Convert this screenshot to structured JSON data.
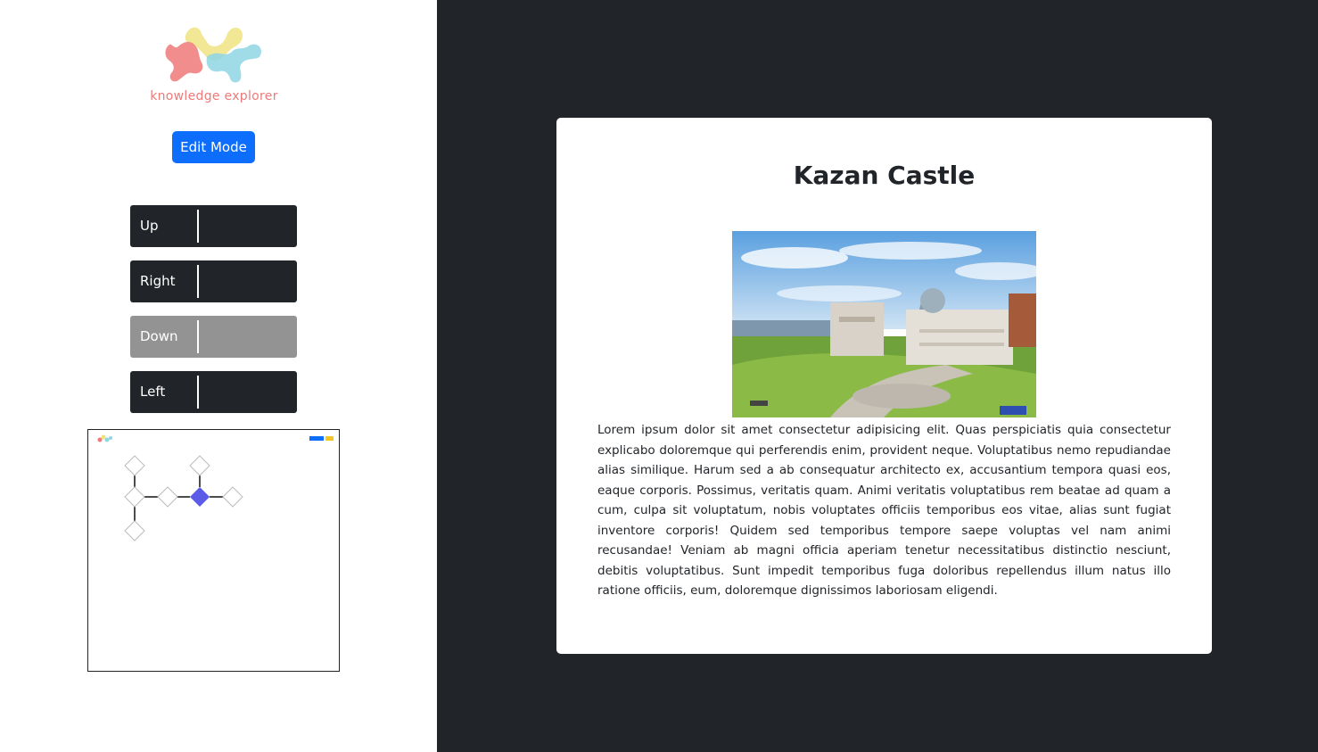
{
  "app": {
    "logo_text": "knowledge explorer",
    "edit_mode_label": "Edit Mode"
  },
  "navigation": {
    "up_label": "Up",
    "right_label": "Right",
    "down_label": "Down",
    "left_label": "Left",
    "down_disabled": true
  },
  "minimap": {
    "header_buttons": [
      "blue",
      "yellow"
    ]
  },
  "article": {
    "title": "Kazan Castle",
    "body": "Lorem ipsum dolor sit amet consectetur adipisicing elit. Quas perspiciatis quia consectetur explicabo doloremque qui perferendis enim, provident neque. Voluptatibus nemo repudiandae alias similique. Harum sed a ab consequatur architecto ex, accusantium tempora quasi eos, eaque corporis. Possimus, veritatis quam. Animi veritatis voluptatibus rem beatae ad quam a cum, culpa sit voluptatum, nobis voluptates officiis temporibus eos vitae, alias sunt fugiat inventore corporis! Quidem sed temporibus tempore saepe voluptas vel nam animi recusandae! Veniam ab magni officia aperiam tenetur necessitatibus distinctio nesciunt, debitis voluptatibus. Sunt impedit temporibus fuga doloribus repellendus illum natus illo ratione officiis, eum, doloremque dignissimos laboriosam eligendi."
  },
  "colors": {
    "primary": "#0d6efd",
    "dark": "#212529",
    "disabled": "#939393",
    "logo_pink": "#ef7a7a",
    "logo_yellow": "#efe07a",
    "logo_cyan": "#8fd6e3",
    "active_node": "#5b5be8"
  }
}
